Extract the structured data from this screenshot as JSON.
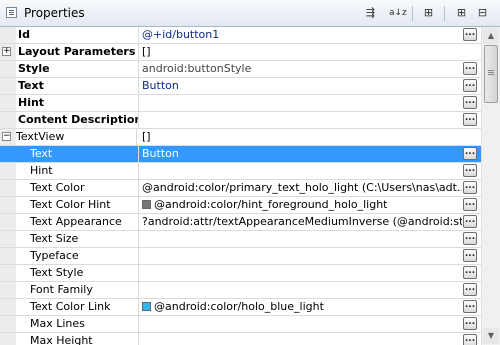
{
  "panel": {
    "title": "Properties",
    "toolbar": [
      {
        "name": "filter-icon",
        "glyph": "⇶"
      },
      {
        "name": "sort-az-icon",
        "glyph": "a↓z"
      },
      {
        "name": "advanced-icon",
        "glyph": "⊞"
      },
      {
        "name": "expand-all-icon",
        "glyph": "⊞"
      },
      {
        "name": "collapse-all-icon",
        "glyph": "⊟"
      }
    ]
  },
  "dots_label": "...",
  "rows": [
    {
      "name": "Id",
      "value": "@+id/button1",
      "bold": true,
      "value_style": "nondefault",
      "dots": true
    },
    {
      "name": "Layout Parameters",
      "value": "[]",
      "bold": true,
      "expander": "+",
      "dots": false
    },
    {
      "name": "Style",
      "value": "android:buttonStyle",
      "bold": true,
      "value_style": "gray",
      "dots": true
    },
    {
      "name": "Text",
      "value": "Button",
      "bold": true,
      "value_style": "nondefault",
      "dots": true
    },
    {
      "name": "Hint",
      "value": "",
      "bold": true,
      "dots": true
    },
    {
      "name": "Content Description",
      "value": "",
      "bold": true,
      "dots": true
    },
    {
      "name": "TextView",
      "value": "[]",
      "expander": "−",
      "category": true,
      "dots": false
    },
    {
      "name": "Text",
      "value": "Button",
      "indent": true,
      "selected": true,
      "dots": true
    },
    {
      "name": "Hint",
      "value": "",
      "indent": true,
      "dots": true
    },
    {
      "name": "Text Color",
      "value": "@android:color/primary_text_holo_light (C:\\Users\\nas\\adt...",
      "indent": true,
      "dots": true
    },
    {
      "name": "Text Color Hint",
      "value": "@android:color/hint_foreground_holo_light",
      "indent": true,
      "swatch": "#777777",
      "dots": true
    },
    {
      "name": "Text Appearance",
      "value": "?android:attr/textAppearanceMediumInverse (@android:st...",
      "indent": true,
      "dots": true
    },
    {
      "name": "Text Size",
      "value": "",
      "indent": true,
      "dots": true
    },
    {
      "name": "Typeface",
      "value": "",
      "indent": true,
      "dots": true
    },
    {
      "name": "Text Style",
      "value": "",
      "indent": true,
      "dots": true
    },
    {
      "name": "Font Family",
      "value": "",
      "indent": true,
      "dots": true
    },
    {
      "name": "Text Color Link",
      "value": "@android:color/holo_blue_light",
      "indent": true,
      "swatch": "#33b5e5",
      "dots": true
    },
    {
      "name": "Max Lines",
      "value": "",
      "indent": true,
      "dots": true
    },
    {
      "name": "Max Height",
      "value": "",
      "indent": true,
      "dots": true
    }
  ],
  "scrollbar": {
    "up_glyph": "▲",
    "down_glyph": "▼"
  }
}
